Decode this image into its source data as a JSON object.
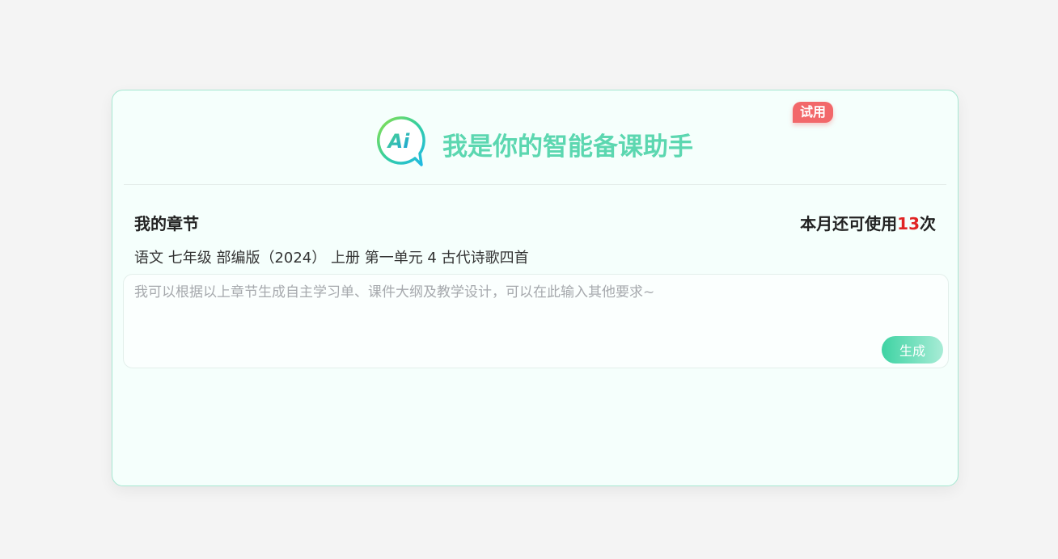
{
  "header": {
    "logo_text": "Ai",
    "title": "我是你的智能备课助手",
    "badge": "试用"
  },
  "chapter": {
    "label": "我的章节",
    "path": "语文 七年级 部编版（2024） 上册 第一单元 4 古代诗歌四首"
  },
  "usage": {
    "prefix": "本月还可使用",
    "count": "13",
    "suffix": "次"
  },
  "input": {
    "placeholder": "我可以根据以上章节生成自主学习单、课件大纲及教学设计，可以在此输入其他要求~",
    "value": ""
  },
  "actions": {
    "generate_label": "生成"
  },
  "colors": {
    "accent": "#5cd7b0",
    "badge": "#f2686a",
    "count": "#e02424",
    "card_background": "#f5fffc",
    "card_border": "#a6e8d2"
  },
  "icons": {
    "logo": "ai-chat-bubble-icon"
  }
}
